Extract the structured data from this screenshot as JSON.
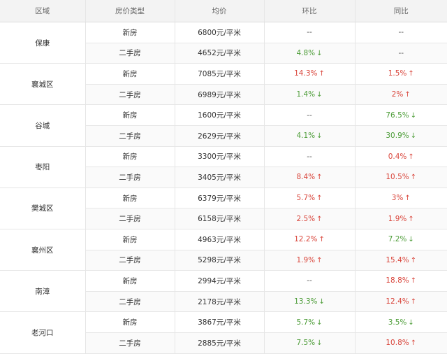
{
  "headers": {
    "region": "区域",
    "type": "房价类型",
    "price": "均价",
    "mom": "环比",
    "yoy": "同比"
  },
  "rows": [
    {
      "region": "保康",
      "entries": [
        {
          "type": "新房",
          "price": "6800元/平米",
          "mom": {
            "text": "--",
            "trend": "none",
            "arrow": ""
          },
          "yoy": {
            "text": "--",
            "trend": "none",
            "arrow": ""
          }
        },
        {
          "type": "二手房",
          "price": "4652元/平米",
          "mom": {
            "text": "4.8%",
            "trend": "down",
            "arrow": "↓"
          },
          "yoy": {
            "text": "--",
            "trend": "none",
            "arrow": ""
          }
        }
      ]
    },
    {
      "region": "襄城区",
      "entries": [
        {
          "type": "新房",
          "price": "7085元/平米",
          "mom": {
            "text": "14.3%",
            "trend": "up",
            "arrow": "↑"
          },
          "yoy": {
            "text": "1.5%",
            "trend": "up",
            "arrow": "↑"
          }
        },
        {
          "type": "二手房",
          "price": "6989元/平米",
          "mom": {
            "text": "1.4%",
            "trend": "down",
            "arrow": "↓"
          },
          "yoy": {
            "text": "2%",
            "trend": "up",
            "arrow": "↑"
          }
        }
      ]
    },
    {
      "region": "谷城",
      "entries": [
        {
          "type": "新房",
          "price": "1600元/平米",
          "mom": {
            "text": "--",
            "trend": "none",
            "arrow": ""
          },
          "yoy": {
            "text": "76.5%",
            "trend": "down",
            "arrow": "↓"
          }
        },
        {
          "type": "二手房",
          "price": "2629元/平米",
          "mom": {
            "text": "4.1%",
            "trend": "down",
            "arrow": "↓"
          },
          "yoy": {
            "text": "30.9%",
            "trend": "down",
            "arrow": "↓"
          }
        }
      ]
    },
    {
      "region": "枣阳",
      "entries": [
        {
          "type": "新房",
          "price": "3300元/平米",
          "mom": {
            "text": "--",
            "trend": "none",
            "arrow": ""
          },
          "yoy": {
            "text": "0.4%",
            "trend": "up",
            "arrow": "↑"
          }
        },
        {
          "type": "二手房",
          "price": "3405元/平米",
          "mom": {
            "text": "8.4%",
            "trend": "up",
            "arrow": "↑"
          },
          "yoy": {
            "text": "10.5%",
            "trend": "up",
            "arrow": "↑"
          }
        }
      ]
    },
    {
      "region": "樊城区",
      "entries": [
        {
          "type": "新房",
          "price": "6379元/平米",
          "mom": {
            "text": "5.7%",
            "trend": "up",
            "arrow": "↑"
          },
          "yoy": {
            "text": "3%",
            "trend": "up",
            "arrow": "↑"
          }
        },
        {
          "type": "二手房",
          "price": "6158元/平米",
          "mom": {
            "text": "2.5%",
            "trend": "up",
            "arrow": "↑"
          },
          "yoy": {
            "text": "1.9%",
            "trend": "up",
            "arrow": "↑"
          }
        }
      ]
    },
    {
      "region": "襄州区",
      "entries": [
        {
          "type": "新房",
          "price": "4963元/平米",
          "mom": {
            "text": "12.2%",
            "trend": "up",
            "arrow": "↑"
          },
          "yoy": {
            "text": "7.2%",
            "trend": "down",
            "arrow": "↓"
          }
        },
        {
          "type": "二手房",
          "price": "5298元/平米",
          "mom": {
            "text": "1.9%",
            "trend": "up",
            "arrow": "↑"
          },
          "yoy": {
            "text": "15.4%",
            "trend": "up",
            "arrow": "↑"
          }
        }
      ]
    },
    {
      "region": "南漳",
      "entries": [
        {
          "type": "新房",
          "price": "2994元/平米",
          "mom": {
            "text": "--",
            "trend": "none",
            "arrow": ""
          },
          "yoy": {
            "text": "18.8%",
            "trend": "up",
            "arrow": "↑"
          }
        },
        {
          "type": "二手房",
          "price": "2178元/平米",
          "mom": {
            "text": "13.3%",
            "trend": "down",
            "arrow": "↓"
          },
          "yoy": {
            "text": "12.4%",
            "trend": "up",
            "arrow": "↑"
          }
        }
      ]
    },
    {
      "region": "老河口",
      "entries": [
        {
          "type": "新房",
          "price": "3867元/平米",
          "mom": {
            "text": "5.7%",
            "trend": "down",
            "arrow": "↓"
          },
          "yoy": {
            "text": "3.5%",
            "trend": "down",
            "arrow": "↓"
          }
        },
        {
          "type": "二手房",
          "price": "2885元/平米",
          "mom": {
            "text": "7.5%",
            "trend": "down",
            "arrow": "↓"
          },
          "yoy": {
            "text": "10.8%",
            "trend": "up",
            "arrow": "↑"
          }
        }
      ]
    }
  ]
}
